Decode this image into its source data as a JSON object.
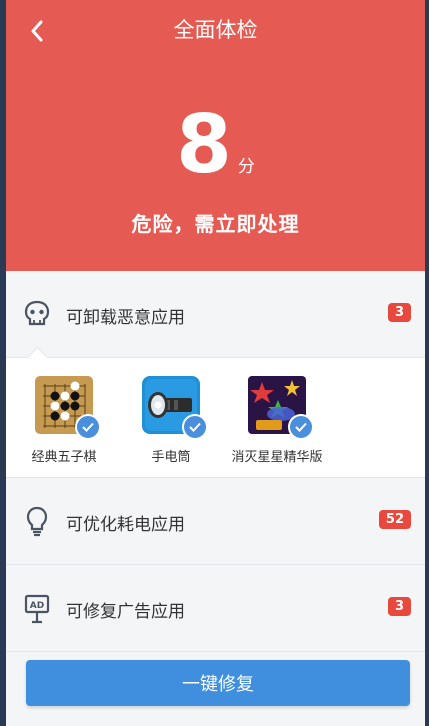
{
  "header": {
    "title": "全面体检",
    "score": "8",
    "score_unit": "分",
    "status": "危险，需立即处理"
  },
  "colors": {
    "header_bg": "#e55a52",
    "badge_bg": "#e8493f",
    "button_bg": "#3f8fde",
    "check_bg": "#4a8fdc"
  },
  "sections": {
    "malicious": {
      "label": "可卸载恶意应用",
      "count": "3",
      "icon": "skull-icon"
    },
    "battery": {
      "label": "可优化耗电应用",
      "count": "52",
      "icon": "lightbulb-icon"
    },
    "ads": {
      "label": "可修复广告应用",
      "count": "3",
      "icon": "ad-sign-icon"
    }
  },
  "apps": [
    {
      "name": "经典五子棋",
      "icon": "gomoku-app-icon"
    },
    {
      "name": "手电筒",
      "icon": "flashlight-app-icon"
    },
    {
      "name": "消灭星星精华版",
      "icon": "popstar-app-icon"
    }
  ],
  "fix_button": {
    "label": "一键修复"
  }
}
